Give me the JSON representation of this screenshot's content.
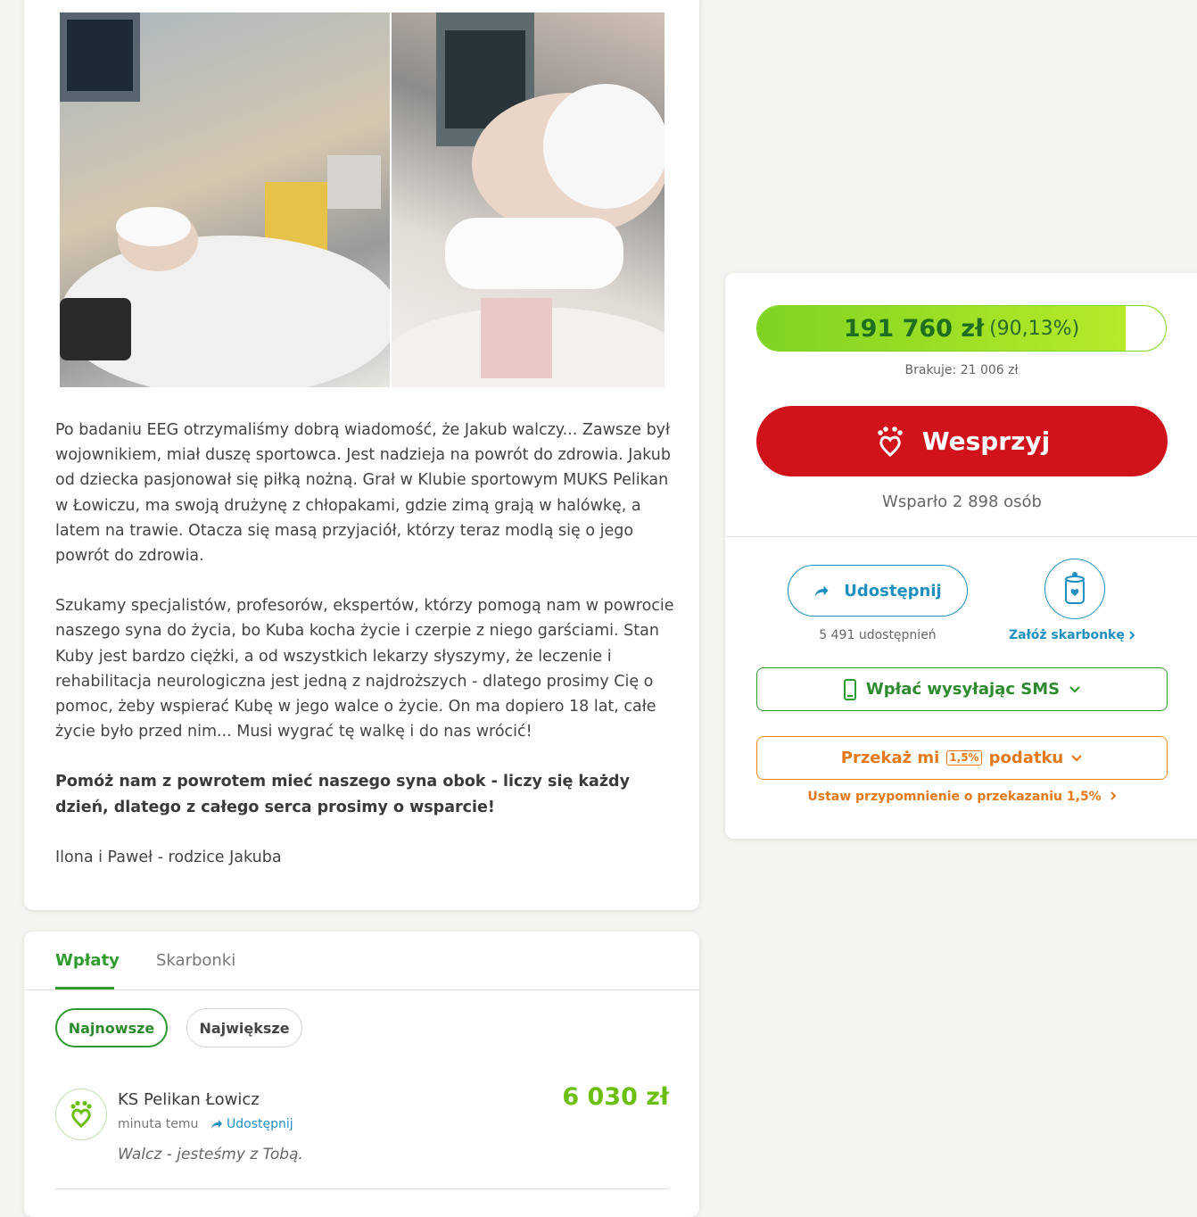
{
  "story": {
    "paragraphs": [
      "Po badaniu EEG otrzymaliśmy dobrą wiadomość, że Jakub walczy... Zawsze był wojownikiem, miał duszę sportowca. Jest nadzieja na powrót do zdrowia. Jakub od dziecka pasjonował się piłką nożną. Grał w Klubie sportowym MUKS Pelikan w Łowiczu, ma swoją drużynę z chłopakami, gdzie zimą grają w halówkę, a latem na trawie. Otacza się masą przyjaciół, którzy teraz modlą się o jego powrót do zdrowia.",
      "Szukamy specjalistów, profesorów, ekspertów, którzy pomogą nam w powrocie naszego syna do życia, bo Kuba kocha życie i czerpie z niego garściami. Stan Kuby jest bardzo ciężki, a od wszystkich lekarzy słyszymy, że leczenie i rehabilitacja neurologiczna jest jedną z najdroższych - dlatego prosimy Cię o pomoc, żeby wspierać Kubę w jego walce o życie. On ma dopiero 18 lat, całe życie było przed nim... Musi wygrać tę walkę i do nas wrócić!",
      "Pomóż nam z powrotem mieć naszego syna obok - liczy się każdy dzień, dlatego z całego serca prosimy o wsparcie!",
      "Ilona i Paweł - rodzice Jakuba"
    ]
  },
  "donations": {
    "tabs": [
      "Wpłaty",
      "Skarbonki"
    ],
    "filters": [
      "Najnowsze",
      "Największe"
    ],
    "items": [
      {
        "name": "KS Pelikan Łowicz",
        "time": "minuta temu",
        "share_label": "Udostępnij",
        "amount": "6 030 zł",
        "message": "Walcz - jesteśmy z Tobą."
      }
    ]
  },
  "support": {
    "raised": "191 760 zł",
    "percent_label": "(90,13%)",
    "progress": 0.9013,
    "missing": "Brakuje: 21 006 zł",
    "button_label": "Wesprzyj",
    "supporters": "Wsparło 2 898 osób",
    "share_label": "Udostępnij",
    "shares_count": "5 491 udostępnień",
    "piggy_label": "Załóż skarbonkę",
    "sms_label": "Wpłać wysyłając SMS",
    "tax_label_1": "Przekaż mi",
    "tax_badge": "1,5%",
    "tax_label_2": "podatku",
    "tax_reminder": "Ustaw przypomnienie o przekazaniu 1,5%"
  },
  "colors": {
    "green": "#2e9b2e",
    "progress_green": "#7ed321",
    "red": "#d0121b",
    "blue": "#1f8fc0",
    "orange": "#e3791a"
  },
  "icons": [
    "heart-hand-icon",
    "share-arrow-icon",
    "piggy-bank-icon",
    "phone-icon",
    "chevron-down-icon",
    "chevron-right-icon"
  ]
}
